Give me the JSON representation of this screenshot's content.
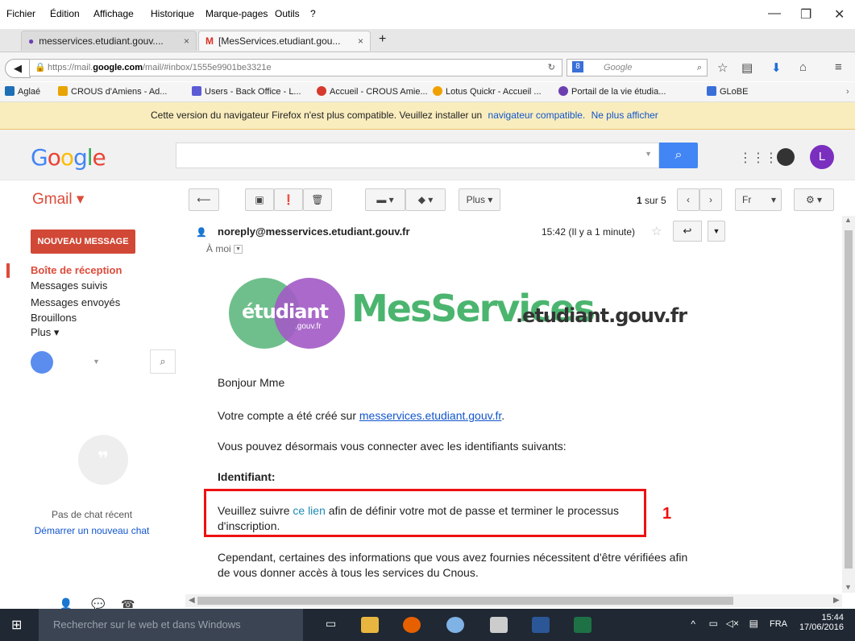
{
  "menubar": {
    "items": [
      "Fichier",
      "Édition",
      "Affichage",
      "Historique",
      "Marque-pages",
      "Outils",
      "?"
    ],
    "minimize": "—",
    "restore": "❐",
    "close": "✕"
  },
  "tabs": [
    {
      "label": "messervices.etudiant.gouv....",
      "close": "×"
    },
    {
      "label": "[MesServices.etudiant.gou...",
      "close": "×"
    }
  ],
  "new_tab": "+",
  "nav": {
    "url_prefix": "https://mail.",
    "url_domain": "google.com",
    "url_path": "/mail/#inbox/1555e9901be3321e",
    "search_engine_placeholder": "Google"
  },
  "bookmarks": [
    {
      "label": "Aglaé",
      "color": "#1f6fb5"
    },
    {
      "label": "CROUS d'Amiens - Ad...",
      "color": "#e8a400"
    },
    {
      "label": "Users - Back Office - L...",
      "color": "#5b5bd6"
    },
    {
      "label": "Accueil - CROUS Amie...",
      "color": "#d63a2f"
    },
    {
      "label": "Lotus Quickr - Accueil ...",
      "color": "#f0a000"
    },
    {
      "label": "Portail de la vie étudia...",
      "color": "#6b3fb0"
    },
    {
      "label": "GLoBE",
      "color": "#3a6fd8"
    }
  ],
  "warning": {
    "text": "Cette version du navigateur Firefox n'est plus compatible. Veuillez installer un",
    "link1": "navigateur compatible.",
    "link2": "Ne plus afficher"
  },
  "google": {
    "logo": "Google",
    "avatar_letter": "L"
  },
  "gmail": {
    "label": "Gmail ▾",
    "more_button": "Plus ▾",
    "pager_current": "1",
    "pager_total": "sur 5",
    "lang": "Fr"
  },
  "leftnav": {
    "new_message": "NOUVEAU MESSAGE",
    "items": [
      "Boîte de réception",
      "Messages suivis",
      "Messages envoyés",
      "Brouillons",
      "Plus ▾"
    ],
    "no_chat": "Pas de chat récent",
    "start_chat": "Démarrer un nouveau chat"
  },
  "message": {
    "sender": "noreply@messervices.etudiant.gouv.fr",
    "recipient": "À moi",
    "time": "15:42 (Il y a 1 minute)",
    "logo_etudiant": "étudiant",
    "logo_gouv": ".gouv.fr",
    "logo_messervices": "MesServices",
    "logo_domain": ".etudiant.gouv.fr",
    "greeting": "Bonjour Mme",
    "p1_before": "Votre compte a été créé sur ",
    "p1_link": "messervices.etudiant.gouv.fr",
    "p1_after": ".",
    "p2": "Vous pouvez désormais vous connecter avec les identifiants suivants:",
    "identifiant": "Identifiant:",
    "p3_before": "Veuillez suivre ",
    "p3_link": "ce lien",
    "p3_after": " afin de définir votre mot de passe et terminer le processus d'inscription.",
    "p4": "Cependant, certaines des informations que vous avez fournies nécessitent d'être vérifiées afin de vous donner accès à tous les services du Cnous."
  },
  "annotation": "1",
  "taskbar": {
    "search_placeholder": "Rechercher sur le web et dans Windows",
    "lang": "FRA",
    "time": "15:44",
    "date": "17/06/2016"
  }
}
